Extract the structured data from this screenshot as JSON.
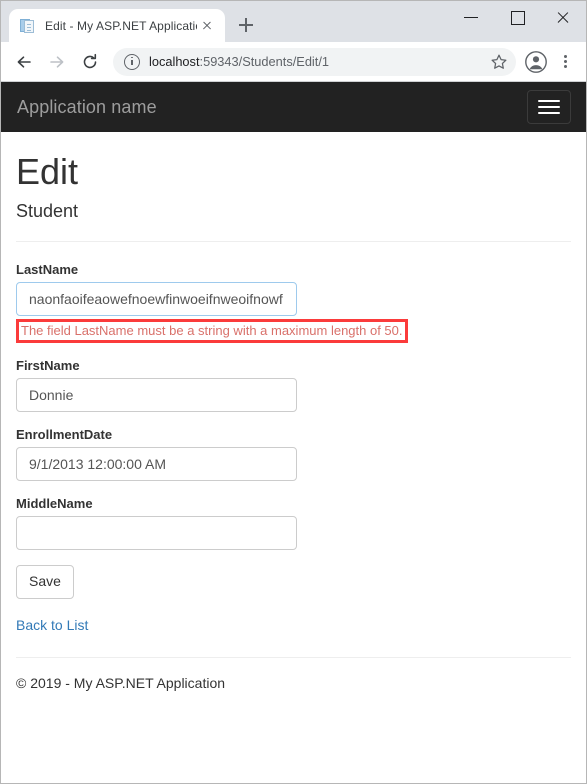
{
  "browser": {
    "tab": {
      "title": "Edit - My ASP.NET Application",
      "favicon": "document-icon",
      "close_icon": "close-icon"
    },
    "new_tab_icon": "plus-icon",
    "window_controls": {
      "minimize": "minimize-icon",
      "maximize": "maximize-icon",
      "close": "close-icon"
    },
    "toolbar": {
      "back_icon": "back-arrow-icon",
      "forward_icon": "forward-arrow-icon",
      "reload_icon": "reload-icon",
      "site_info_icon": "info-circle-icon",
      "url_host": "localhost",
      "url_path": ":59343/Students/Edit/1",
      "bookmark_icon": "star-icon",
      "profile_icon": "account-avatar-icon",
      "menu_icon": "kebab-menu-icon"
    }
  },
  "page": {
    "navbar": {
      "brand": "Application name",
      "toggle_icon": "hamburger-icon"
    },
    "title": "Edit",
    "subtitle": "Student",
    "fields": [
      {
        "label": "LastName",
        "value": "naonfaoifeaowefnoewfinwoeifnweoifnowf",
        "focused": true,
        "error": "The field LastName must be a string with a maximum length of 50."
      },
      {
        "label": "FirstName",
        "value": "Donnie",
        "focused": false,
        "error": ""
      },
      {
        "label": "EnrollmentDate",
        "value": "9/1/2013 12:00:00 AM",
        "focused": false,
        "error": ""
      },
      {
        "label": "MiddleName",
        "value": "",
        "focused": false,
        "error": ""
      }
    ],
    "save_label": "Save",
    "back_link": "Back to List",
    "footer": "© 2019 - My ASP.NET Application",
    "colors": {
      "navbar_bg": "#222222",
      "brand_text": "#9d9d9d",
      "link": "#337ab7",
      "error_border": "#fb3b3b",
      "error_text": "#d9706a",
      "input_focus_border": "#9ecaed"
    }
  }
}
